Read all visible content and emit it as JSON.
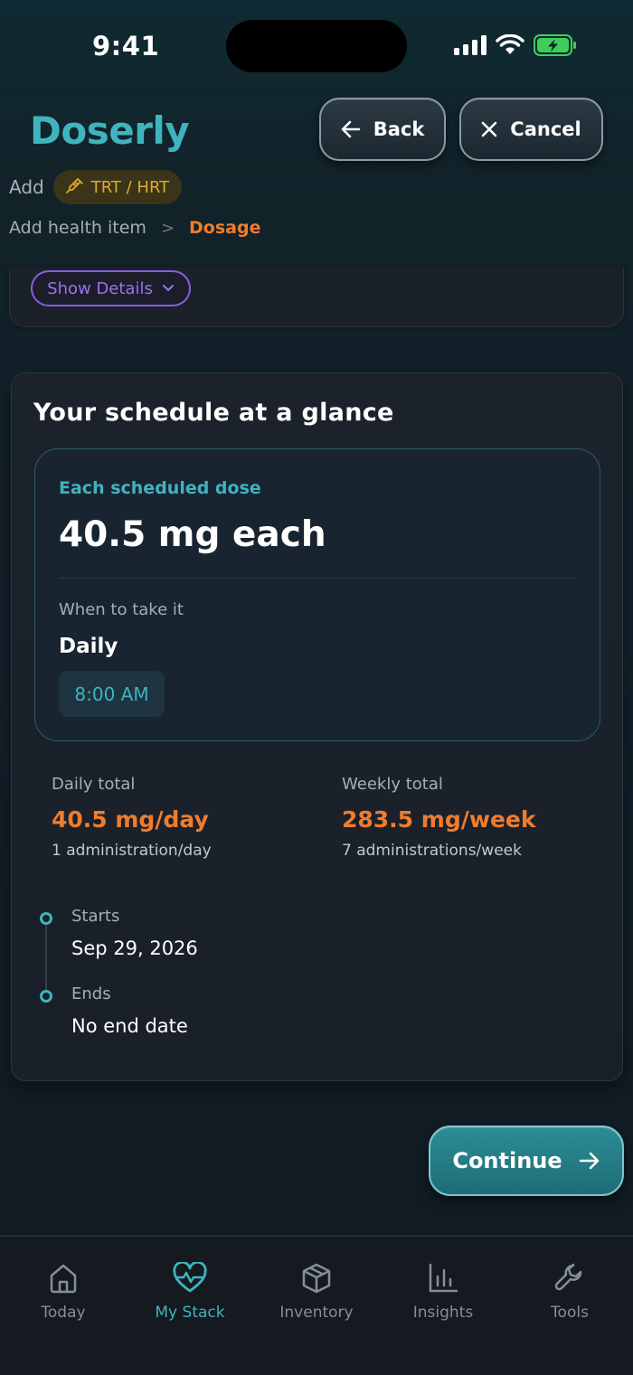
{
  "status_bar": {
    "time": "9:41"
  },
  "app": {
    "brand": "Doserly"
  },
  "nav": {
    "back_label": "Back",
    "cancel_label": "Cancel"
  },
  "add_row": {
    "label": "Add",
    "chip_label": "TRT / HRT"
  },
  "breadcrumb": {
    "item1": "Add health item",
    "separator": ">",
    "item2": "Dosage"
  },
  "details": {
    "toggle_label": "Show Details"
  },
  "schedule": {
    "title": "Your schedule at a glance",
    "dose_label": "Each scheduled dose",
    "dose_value": "40.5 mg each",
    "when_label": "When to take it",
    "frequency": "Daily",
    "time": "8:00 AM",
    "daily_label": "Daily total",
    "daily_value": "40.5 mg/day",
    "daily_sub": "1 administration/day",
    "weekly_label": "Weekly total",
    "weekly_value": "283.5 mg/week",
    "weekly_sub": "7 administrations/week",
    "starts_label": "Starts",
    "starts_value": "Sep 29, 2026",
    "ends_label": "Ends",
    "ends_value": "No end date"
  },
  "footer": {
    "continue_label": "Continue"
  },
  "tabs": [
    {
      "label": "Today",
      "icon": "home-icon",
      "active": false
    },
    {
      "label": "My Stack",
      "icon": "heart-pulse-icon",
      "active": true
    },
    {
      "label": "Inventory",
      "icon": "box-icon",
      "active": false
    },
    {
      "label": "Insights",
      "icon": "bar-chart-icon",
      "active": false
    },
    {
      "label": "Tools",
      "icon": "wrench-icon",
      "active": false
    }
  ],
  "colors": {
    "accent_teal": "#3fb4bf",
    "accent_orange": "#f07c2d",
    "accent_purple": "#8a5ce3",
    "chip_gold": "#e0a830"
  }
}
